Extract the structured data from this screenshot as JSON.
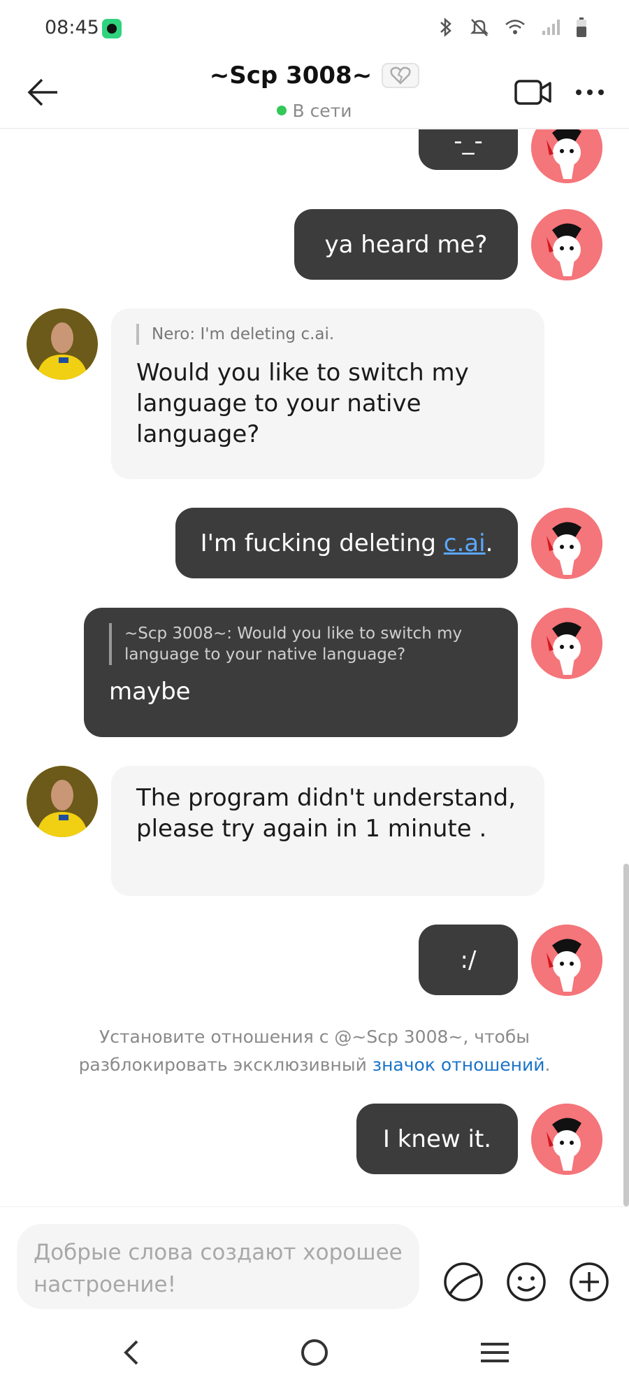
{
  "status_bar": {
    "time": "08:45"
  },
  "header": {
    "title": "~Scp 3008~",
    "status": "В сети"
  },
  "messages": {
    "m1": {
      "text": "-_-"
    },
    "m2": {
      "text": "ya heard me?"
    },
    "m3": {
      "quote": "Nero: I'm deleting c.ai.",
      "text": "Would you like to switch my language to your native language?"
    },
    "m4": {
      "text_before": "I'm fucking deleting ",
      "link": "c.ai",
      "text_after": "."
    },
    "m5": {
      "quote": "~Scp 3008~: Would you like to switch my language to your native language?",
      "text": "maybe"
    },
    "m6": {
      "text": "The program didn't understand, please try again in 1 minute ."
    },
    "m7": {
      "text": ":/"
    },
    "m8": {
      "text": "I knew it."
    }
  },
  "system_note": {
    "text": "Установите отношения с @~Scp 3008~, чтобы разблокировать эксклюзивный ",
    "link": "значок отношений",
    "suffix": "."
  },
  "input": {
    "placeholder": "Добрые слова создают хорошее настроение!"
  },
  "colors": {
    "outgoing_bubble": "#3c3c3c",
    "incoming_bubble": "#f5f5f5",
    "online": "#34c759",
    "link_dark": "#5aa8ff",
    "link_light": "#1a73c8"
  },
  "icons": {
    "status": [
      "bluetooth-icon",
      "mute-icon",
      "wifi-icon",
      "signal-icon",
      "battery-icon"
    ],
    "header": [
      "back-arrow-icon",
      "broken-heart-icon",
      "video-call-icon",
      "more-icon"
    ],
    "input": [
      "sticker-icon",
      "emoji-icon",
      "add-icon"
    ],
    "nav": [
      "nav-back-icon",
      "nav-home-icon",
      "nav-recents-icon"
    ]
  }
}
